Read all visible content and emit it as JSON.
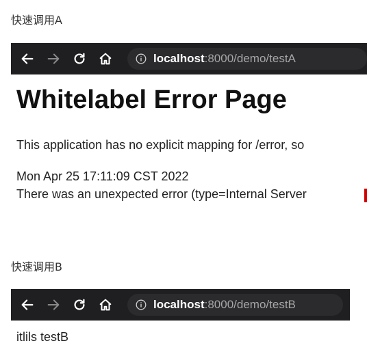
{
  "section_a": {
    "caption": "快速调用A",
    "browser": {
      "url_host": "localhost",
      "url_path": ":8000/demo/testA"
    },
    "error_page": {
      "title": "Whitelabel Error Page",
      "message": "This application has no explicit mapping for /error, so",
      "timestamp": "Mon Apr 25 17:11:09 CST 2022",
      "detail": "There was an unexpected error (type=Internal Server"
    }
  },
  "section_b": {
    "caption": "快速调用B",
    "browser": {
      "url_host": "localhost",
      "url_path": ":8000/demo/testB"
    },
    "response_text": "itlils testB"
  },
  "icons": {
    "back": "back-arrow-icon",
    "forward": "forward-arrow-icon",
    "reload": "reload-icon",
    "home": "home-icon",
    "info": "info-icon"
  },
  "colors": {
    "toolbar_bg": "#1f1f21",
    "omnibox_bg": "#2b2b2e",
    "url_host": "#ffffff",
    "url_path": "#a6a6a6",
    "forward_disabled": "#8a8a8a"
  }
}
